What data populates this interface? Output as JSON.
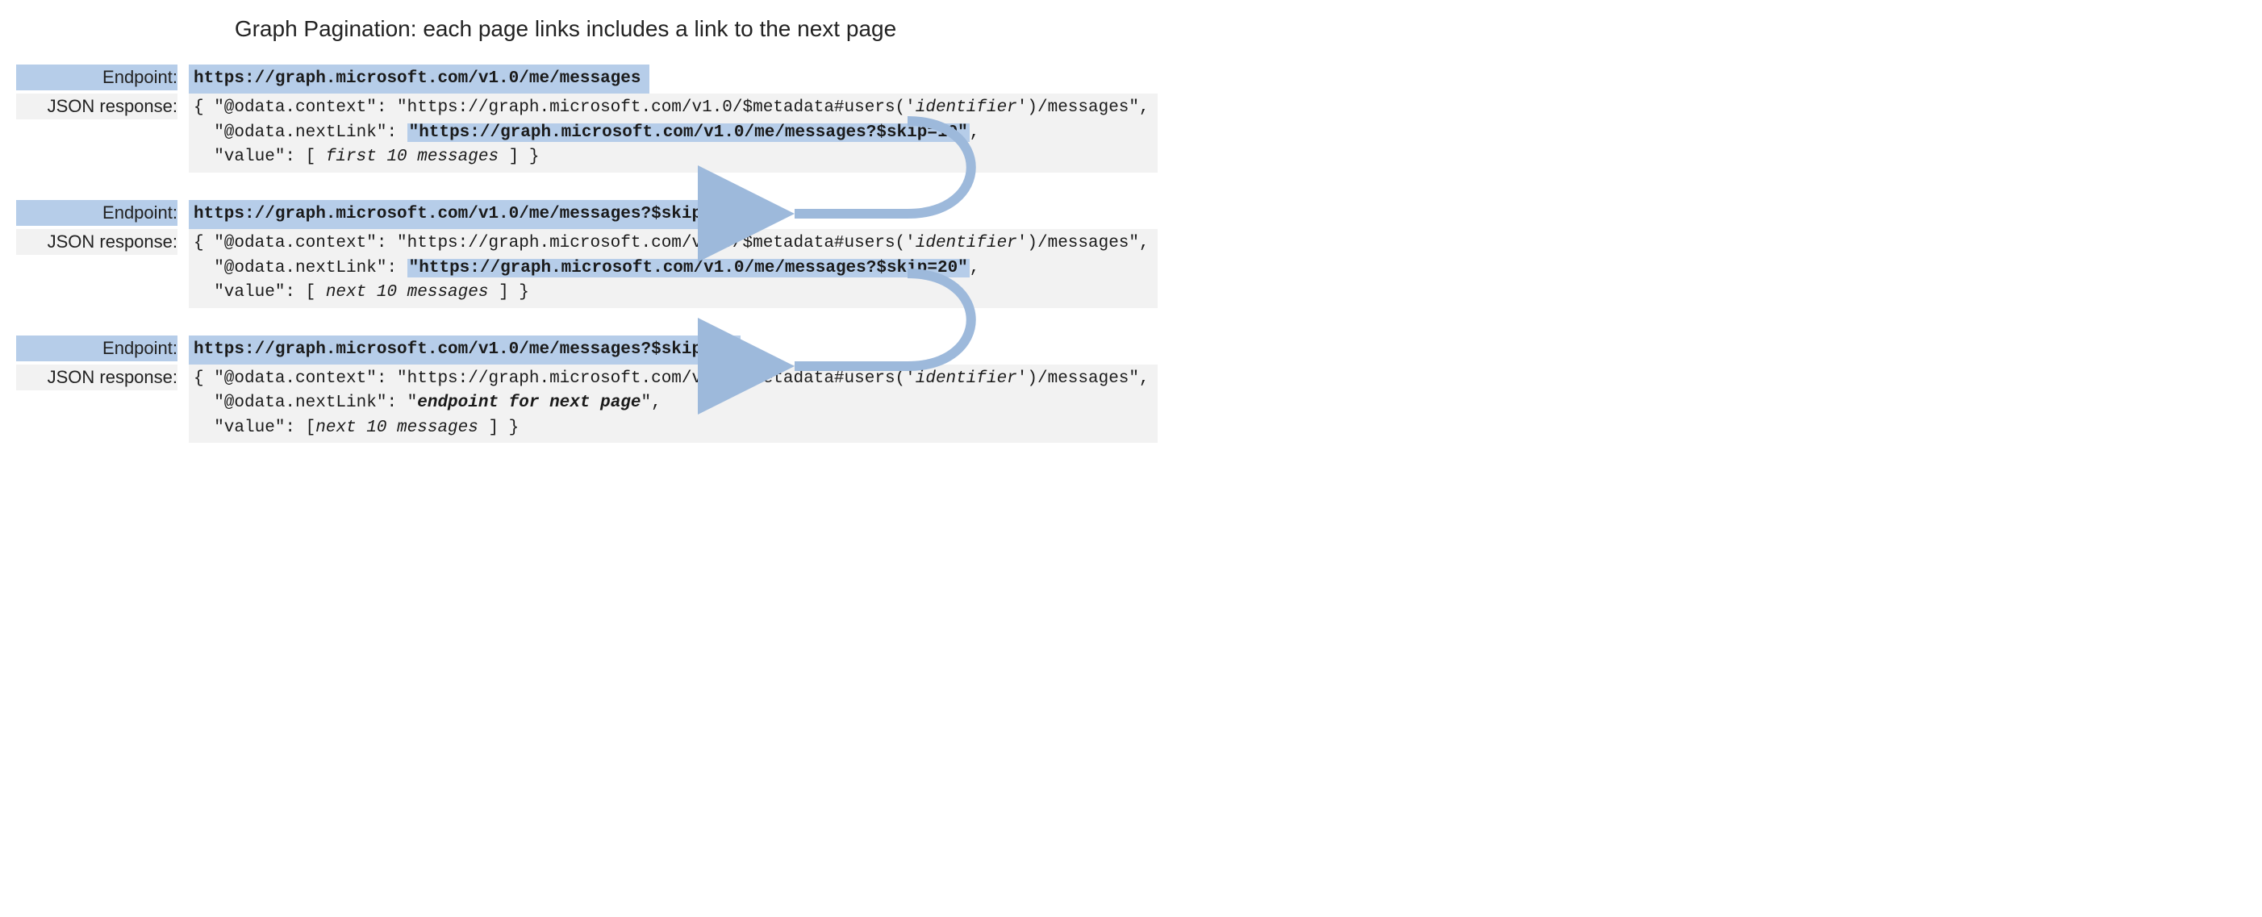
{
  "title": "Graph Pagination: each page links includes a link to the next page",
  "labels": {
    "endpoint": "Endpoint:",
    "json": "JSON response:"
  },
  "colors": {
    "highlight": "#b6cde9",
    "panel": "#f2f2f2",
    "arrow": "#9db9db"
  },
  "pages": [
    {
      "endpoint": "https://graph.microsoft.com/v1.0/me/messages",
      "json": {
        "prefix1": "{ \"@odata.context\": \"https://graph.microsoft.com/v1.0/$metadata#users('",
        "identifier": "identifier",
        "suffix1": "')/messages\",",
        "nextKey": "  \"@odata.nextLink\": ",
        "nextVal": "\"https://graph.microsoft.com/v1.0/me/messages?$skip=10\"",
        "nextTail": ",",
        "valLine": "  \"value\": [ ",
        "valItalic": "first 10 messages",
        "valEnd": " ] }"
      }
    },
    {
      "endpoint": "https://graph.microsoft.com/v1.0/me/messages?$skip=10",
      "json": {
        "prefix1": "{ \"@odata.context\": \"https://graph.microsoft.com/v1.0/$metadata#users('",
        "identifier": "identifier",
        "suffix1": "')/messages\",",
        "nextKey": "  \"@odata.nextLink\": ",
        "nextVal": "\"https://graph.microsoft.com/v1.0/me/messages?$skip=20\"",
        "nextTail": ",",
        "valLine": "  \"value\": [ ",
        "valItalic": "next 10 messages",
        "valEnd": " ] }"
      }
    },
    {
      "endpoint": "https://graph.microsoft.com/v1.0/me/messages?$skip=20",
      "json": {
        "prefix1": "{ \"@odata.context\": \"https://graph.microsoft.com/v1.0/$metadata#users('",
        "identifier": "identifier",
        "suffix1": "')/messages\",",
        "nextKey": "  \"@odata.nextLink\": \"",
        "nextItalic": "endpoint for next page",
        "nextTail2": "\",",
        "valLine": "  \"value\": [",
        "valItalic": "next 10 messages",
        "valEnd": " ] }"
      }
    }
  ]
}
